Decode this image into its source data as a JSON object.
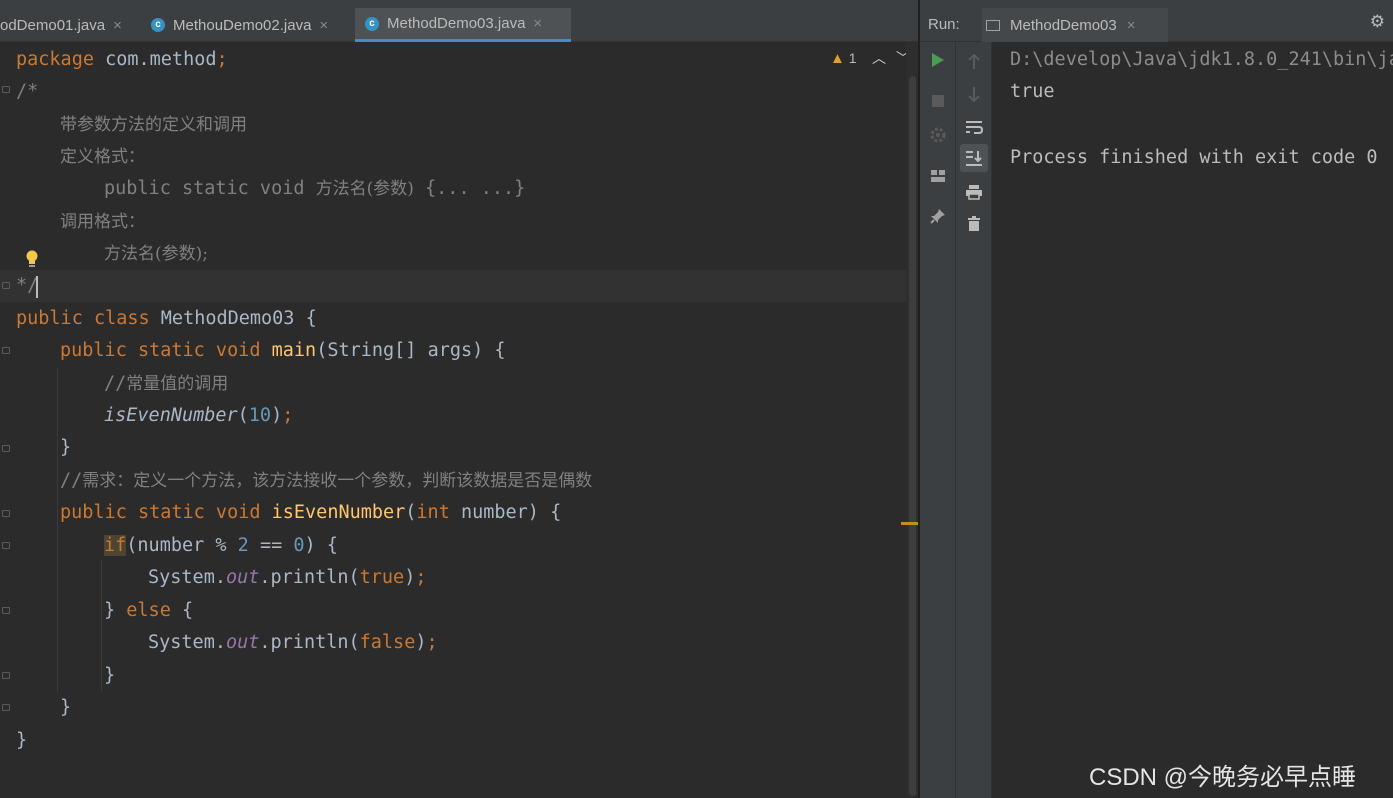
{
  "editor_tabs": [
    {
      "label": "odDemo01.java",
      "active": false,
      "close": "×"
    },
    {
      "label": "MethouDemo02.java",
      "active": false,
      "close": "×"
    },
    {
      "label": "MethodDemo03.java",
      "active": true,
      "close": "×"
    }
  ],
  "warnings": {
    "count": "1"
  },
  "code": {
    "l1": {
      "kw": "package",
      "rest": " com.method",
      "semi": ";"
    },
    "l2": "/*",
    "l3": "带参数方法的定义和调用",
    "l4": "定义格式：",
    "l5": {
      "code": "public static void ",
      "cn": "方法名(参数)",
      "rest": " {... ...}"
    },
    "l6": "调用格式：",
    "l7": "方法名(参数);",
    "l8": "*/",
    "l9": {
      "kw": "public class",
      "name": " MethodDemo03 {"
    },
    "l10": {
      "kw": "public static void",
      "fn": "main",
      "rest": "(String[] args) {"
    },
    "l11": {
      "slashes": "//",
      "cn": "常量值的调用"
    },
    "l12": {
      "call": "isEvenNumber",
      "open": "(",
      "num": "10",
      "close": ")",
      "semi": ";"
    },
    "l13": "}",
    "l14": {
      "slashes": "//",
      "cn": "需求：定义一个方法，该方法接收一个参数，判断该数据是否是偶数"
    },
    "l15": {
      "kw": "public static void",
      "fn": "isEvenNumber",
      "open": "(",
      "kw2": "int",
      "rest": " number) {"
    },
    "l16": {
      "kw": "if",
      "a": "(number % ",
      "n1": "2",
      "b": " == ",
      "n2": "0",
      "c": ") {"
    },
    "l17": {
      "a": "System.",
      "field": "out",
      "b": ".println(",
      "val": "true",
      "c": ")",
      "semi": ";"
    },
    "l18": {
      "a": "} ",
      "kw": "else",
      "b": " {"
    },
    "l19": {
      "a": "System.",
      "field": "out",
      "b": ".println(",
      "val": "false",
      "c": ")",
      "semi": ";"
    },
    "l20": "}",
    "l21": "}",
    "l22": "}"
  },
  "run_panel": {
    "label": "Run:",
    "tab_label": "MethodDemo03",
    "tab_close": "×",
    "settings_icon": "⚙"
  },
  "console": {
    "command": "D:\\develop\\Java\\jdk1.8.0_241\\bin\\ja",
    "output": "true",
    "exit_message": "Process finished with exit code 0"
  },
  "watermark": "CSDN @今晚务必早点睡",
  "colors": {
    "editor_bg": "#2b2b2b",
    "keyword": "#cc7832",
    "function": "#ffc66d",
    "number": "#6897bb",
    "comment": "#808080",
    "field": "#9876aa",
    "run_green": "#499c54"
  }
}
